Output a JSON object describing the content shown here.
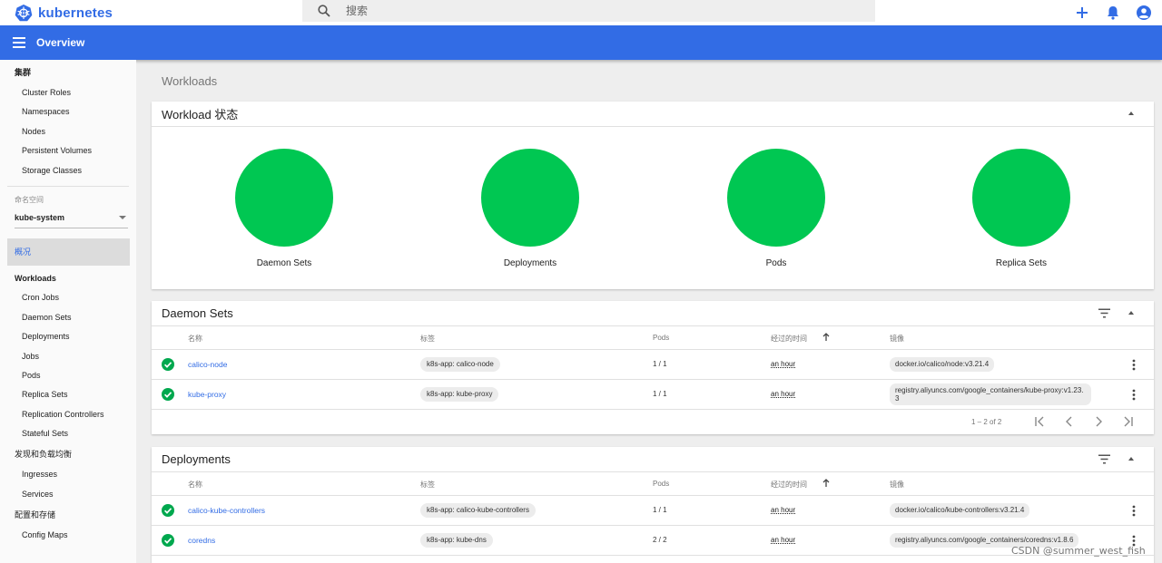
{
  "brand": {
    "name": "kubernetes"
  },
  "search": {
    "placeholder": "搜索"
  },
  "header": {
    "title": "Overview"
  },
  "sidebar": {
    "cluster_heading": "集群",
    "cluster_items": [
      "Cluster Roles",
      "Namespaces",
      "Nodes",
      "Persistent Volumes",
      "Storage Classes"
    ],
    "namespace_label": "命名空间",
    "namespace_value": "kube-system",
    "overview_label": "概况",
    "workloads_heading": "Workloads",
    "workload_items": [
      "Cron Jobs",
      "Daemon Sets",
      "Deployments",
      "Jobs",
      "Pods",
      "Replica Sets",
      "Replication Controllers",
      "Stateful Sets"
    ],
    "discovery_heading": "发现和负载均衡",
    "discovery_items": [
      "Ingresses",
      "Services"
    ],
    "config_heading": "配置和存储",
    "config_items": [
      "Config Maps"
    ]
  },
  "main": {
    "page_title": "Workloads",
    "status_card": {
      "title": "Workload 状态",
      "circles": [
        "Daemon Sets",
        "Deployments",
        "Pods",
        "Replica Sets"
      ]
    },
    "columns": {
      "name": "名称",
      "labels": "标签",
      "pods": "Pods",
      "age": "经过的时间",
      "images": "镜像"
    },
    "daemon_sets": {
      "title": "Daemon Sets",
      "rows": [
        {
          "name": "calico-node",
          "label": "k8s-app: calico-node",
          "pods": "1 / 1",
          "age": "an hour",
          "image": "docker.io/calico/node:v3.21.4"
        },
        {
          "name": "kube-proxy",
          "label": "k8s-app: kube-proxy",
          "pods": "1 / 1",
          "age": "an hour",
          "image": "registry.aliyuncs.com/google_containers/kube-proxy:v1.23.3"
        }
      ],
      "pager_range": "1 – 2 of 2"
    },
    "deployments": {
      "title": "Deployments",
      "rows": [
        {
          "name": "calico-kube-controllers",
          "label": "k8s-app: calico-kube-controllers",
          "pods": "1 / 1",
          "age": "an hour",
          "image": "docker.io/calico/kube-controllers:v3.21.4"
        },
        {
          "name": "coredns",
          "label": "k8s-app: kube-dns",
          "pods": "2 / 2",
          "age": "an hour",
          "image": "registry.aliyuncs.com/google_containers/coredns:v1.8.6"
        }
      ]
    }
  },
  "watermark": "CSDN @summer_west_fish",
  "colors": {
    "brand": "#326ce5",
    "status_ok": "#00c752"
  }
}
